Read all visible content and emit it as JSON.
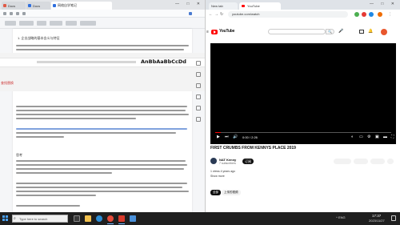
{
  "left_window": {
    "tabs": [
      {
        "label": "Docs",
        "color": "#e05a47"
      },
      {
        "label": "Docs",
        "color": "#2f6fde"
      },
      {
        "label": "网络自学笔记",
        "color": "#2f6fde",
        "active": true
      }
    ],
    "window_buttons": "— □ ✕",
    "find_tag": "查找替换",
    "search_highlight": "AnBbAaBbCcDd",
    "heading": "1. 企业战略的基本含义与特征",
    "section_heading": "思考"
  },
  "right_window": {
    "tabs": [
      {
        "label": "New tab"
      },
      {
        "label": "YouTube",
        "active": true
      }
    ],
    "window_buttons": "— □ ✕",
    "address": "youtube.com/watch",
    "youtube": {
      "logo_text": "YouTube",
      "search_button": "🔍",
      "mic": "🎤"
    },
    "video": {
      "progress_fraction": 0.03,
      "time": "0:00 / 2:26",
      "title": "FIRST CRUMBS FROM KENNYS PLACE 2019",
      "channel": "NAT Kenny",
      "subscribers": "7 subscribers",
      "subscribe_label": "订阅",
      "description_line1": "1 views  4 years ago",
      "description_line2": "Show more",
      "chips": [
        "全部",
        "上传的视频"
      ]
    }
  },
  "taskbar": {
    "search_placeholder": "Type here to search",
    "tray_text": "^ ENG",
    "clock_time": "17:37",
    "clock_date": "2023/11/27"
  }
}
